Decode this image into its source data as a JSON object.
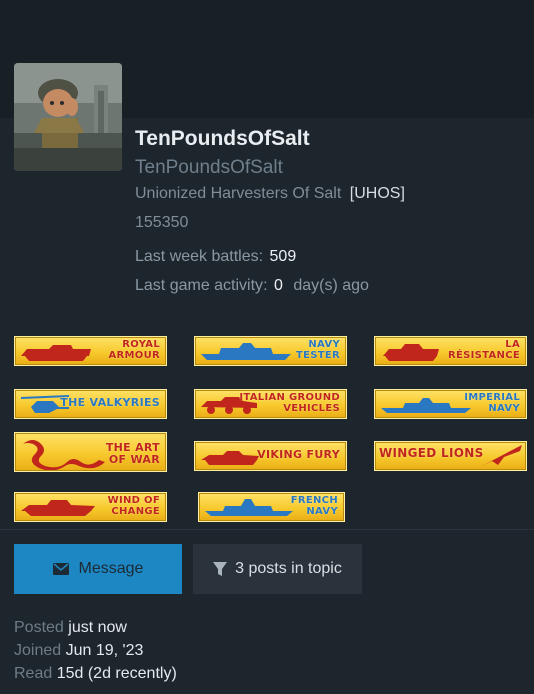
{
  "profile": {
    "display_name": "TenPoundsOfSalt",
    "username": "TenPoundsOfSalt",
    "clan_name": "Unionized Harvesters Of Salt",
    "clan_tag": "[UHOS]",
    "user_id": "155350",
    "last_week_battles_label": "Last week battles",
    "last_week_battles_value": "509",
    "last_activity_label": "Last game activity",
    "last_activity_value": "0",
    "last_activity_suffix": "day(s) ago"
  },
  "badges": [
    {
      "line1": "ROYAL",
      "line2": "ARMOUR",
      "icon": "tank-icon"
    },
    {
      "line1": "NAVY",
      "line2": "TESTER",
      "icon": "battleship-icon"
    },
    {
      "line1": "LA",
      "line2": "RÉSISTANCE",
      "icon": "tank-icon"
    },
    {
      "line1": "THE VALKYRIES",
      "icon": "helicopter-icon"
    },
    {
      "line1": "ITALIAN GROUND",
      "line2": "VEHICLES",
      "icon": "armored-car-icon"
    },
    {
      "line1": "IMPERIAL",
      "line2": "NAVY",
      "icon": "battleship-icon"
    },
    {
      "line1": "THE ART",
      "line2": "OF WAR",
      "icon": "dragon-icon"
    },
    {
      "line1": "VIKING FURY",
      "icon": "tank-icon"
    },
    {
      "line1": "WINGED LIONS",
      "icon": "jet-icon"
    },
    {
      "line1": "WIND OF",
      "line2": "CHANGE",
      "icon": "tank-icon"
    },
    {
      "line1": "FRENCH",
      "line2": "NAVY",
      "icon": "battleship-icon"
    }
  ],
  "actions": {
    "message_label": "Message",
    "posts_label": "3 posts in topic"
  },
  "post_meta": {
    "posted_label": "Posted",
    "posted_value": "just now",
    "joined_label": "Joined",
    "joined_value": "Jun 19, '23",
    "read_label": "Read",
    "read_value": "15d (2d recently)"
  },
  "colors": {
    "accent": "#1d87c3",
    "badge_gold": "#f7c92d",
    "badge_red": "#c0261c",
    "badge_blue": "#2a78c2"
  }
}
